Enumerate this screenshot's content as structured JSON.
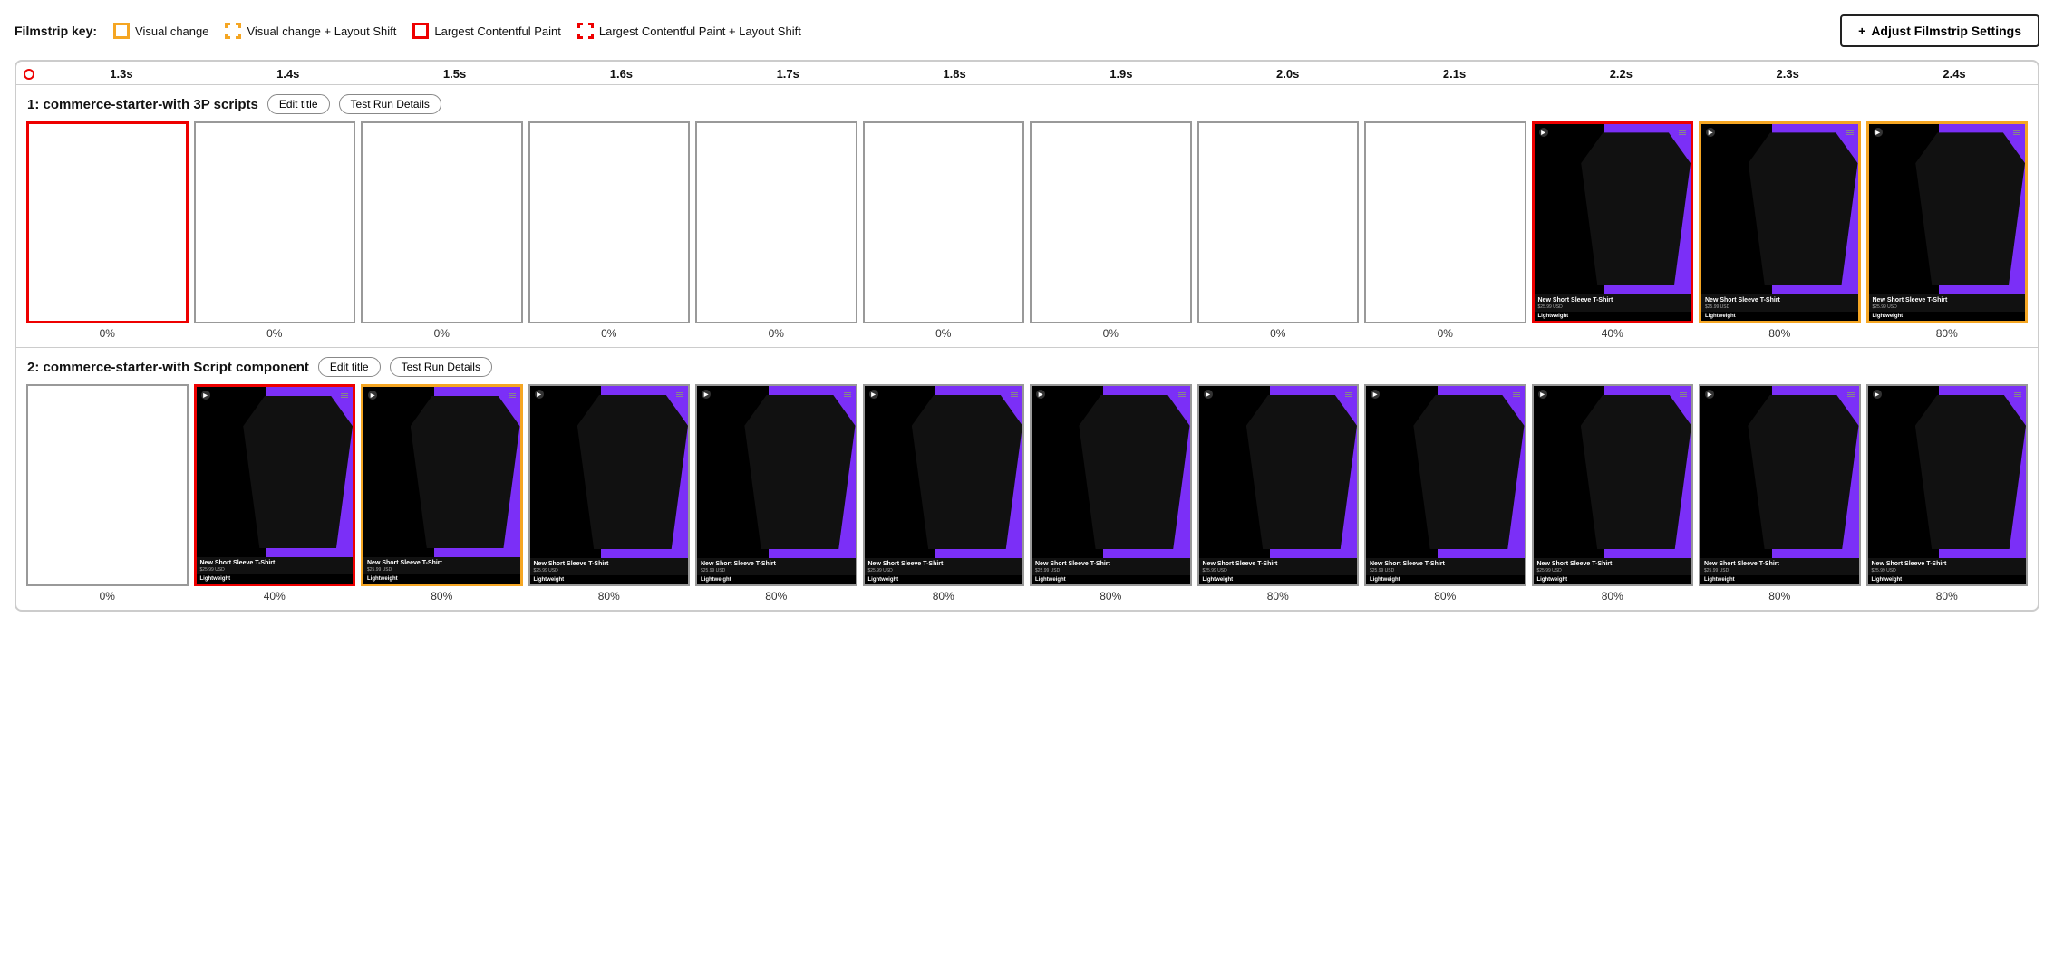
{
  "legend": {
    "label": "Filmstrip key:",
    "items": [
      {
        "id": "visual-change",
        "box": "solid-yellow",
        "text": "Visual change"
      },
      {
        "id": "visual-change-layout-shift",
        "box": "dashed-yellow",
        "text": "Visual change + Layout Shift"
      },
      {
        "id": "lcp",
        "box": "solid-red",
        "text": "Largest Contentful Paint"
      },
      {
        "id": "lcp-layout-shift",
        "box": "dashed-red",
        "text": "Largest Contentful Paint + Layout Shift"
      }
    ]
  },
  "adjust_btn": {
    "label": "Adjust Filmstrip Settings",
    "icon": "+"
  },
  "timeline": {
    "ticks": [
      "1.3s",
      "1.4s",
      "1.5s",
      "1.6s",
      "1.7s",
      "1.8s",
      "1.9s",
      "2.0s",
      "2.1s",
      "2.2s",
      "2.3s",
      "2.4s"
    ]
  },
  "rows": [
    {
      "id": "row1",
      "title": "1: commerce-starter-with 3P scripts",
      "edit_label": "Edit title",
      "details_label": "Test Run Details",
      "frames": [
        {
          "border": "red-solid",
          "empty": true,
          "percent": "0%"
        },
        {
          "border": "none",
          "empty": true,
          "percent": "0%"
        },
        {
          "border": "none",
          "empty": true,
          "percent": "0%"
        },
        {
          "border": "none",
          "empty": true,
          "percent": "0%"
        },
        {
          "border": "none",
          "empty": true,
          "percent": "0%"
        },
        {
          "border": "none",
          "empty": true,
          "percent": "0%"
        },
        {
          "border": "none",
          "empty": true,
          "percent": "0%"
        },
        {
          "border": "none",
          "empty": true,
          "percent": "0%"
        },
        {
          "border": "none",
          "empty": true,
          "percent": "0%"
        },
        {
          "border": "red-solid",
          "empty": false,
          "percent": "40%"
        },
        {
          "border": "yellow-solid",
          "empty": false,
          "percent": "80%"
        },
        {
          "border": "yellow-solid",
          "empty": false,
          "percent": "80%"
        }
      ]
    },
    {
      "id": "row2",
      "title": "2: commerce-starter-with Script component",
      "edit_label": "Edit title",
      "details_label": "Test Run Details",
      "frames": [
        {
          "border": "none",
          "empty": true,
          "percent": "0%"
        },
        {
          "border": "red-solid",
          "empty": false,
          "percent": "40%"
        },
        {
          "border": "yellow-solid",
          "empty": false,
          "percent": "80%"
        },
        {
          "border": "none",
          "empty": false,
          "percent": "80%"
        },
        {
          "border": "none",
          "empty": false,
          "percent": "80%"
        },
        {
          "border": "none",
          "empty": false,
          "percent": "80%"
        },
        {
          "border": "none",
          "empty": false,
          "percent": "80%"
        },
        {
          "border": "none",
          "empty": false,
          "percent": "80%"
        },
        {
          "border": "none",
          "empty": false,
          "percent": "80%"
        },
        {
          "border": "none",
          "empty": false,
          "percent": "80%"
        },
        {
          "border": "none",
          "empty": false,
          "percent": "80%"
        },
        {
          "border": "none",
          "empty": false,
          "percent": "80%"
        }
      ]
    }
  ],
  "product": {
    "name": "New Short Sleeve T-Shirt",
    "price": "$25.99 USD",
    "footer": "Lightweight"
  }
}
